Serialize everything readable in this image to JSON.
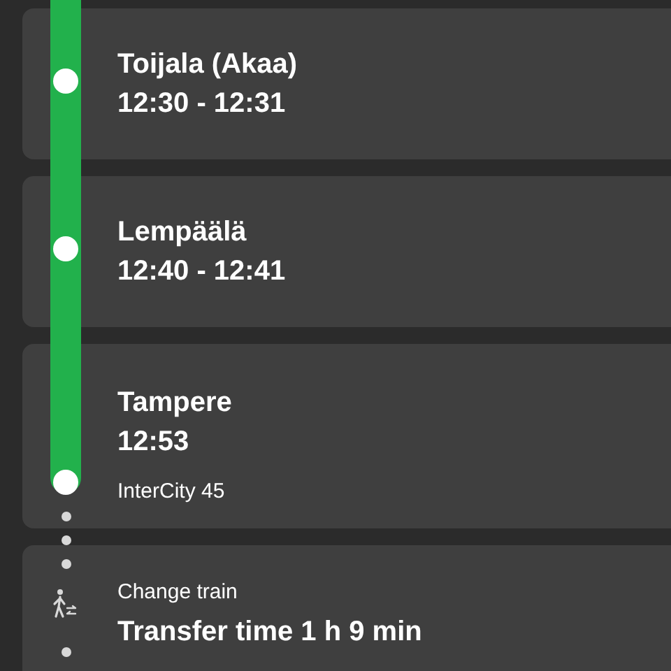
{
  "stops": [
    {
      "name": "Toijala (Akaa)",
      "time": "12:30 - 12:31"
    },
    {
      "name": "Lempäälä",
      "time": "12:40 - 12:41"
    },
    {
      "name": "Tampere",
      "time": "12:53",
      "train": "InterCity 45"
    }
  ],
  "transfer": {
    "label": "Change train",
    "duration": "Transfer time 1 h 9 min"
  }
}
